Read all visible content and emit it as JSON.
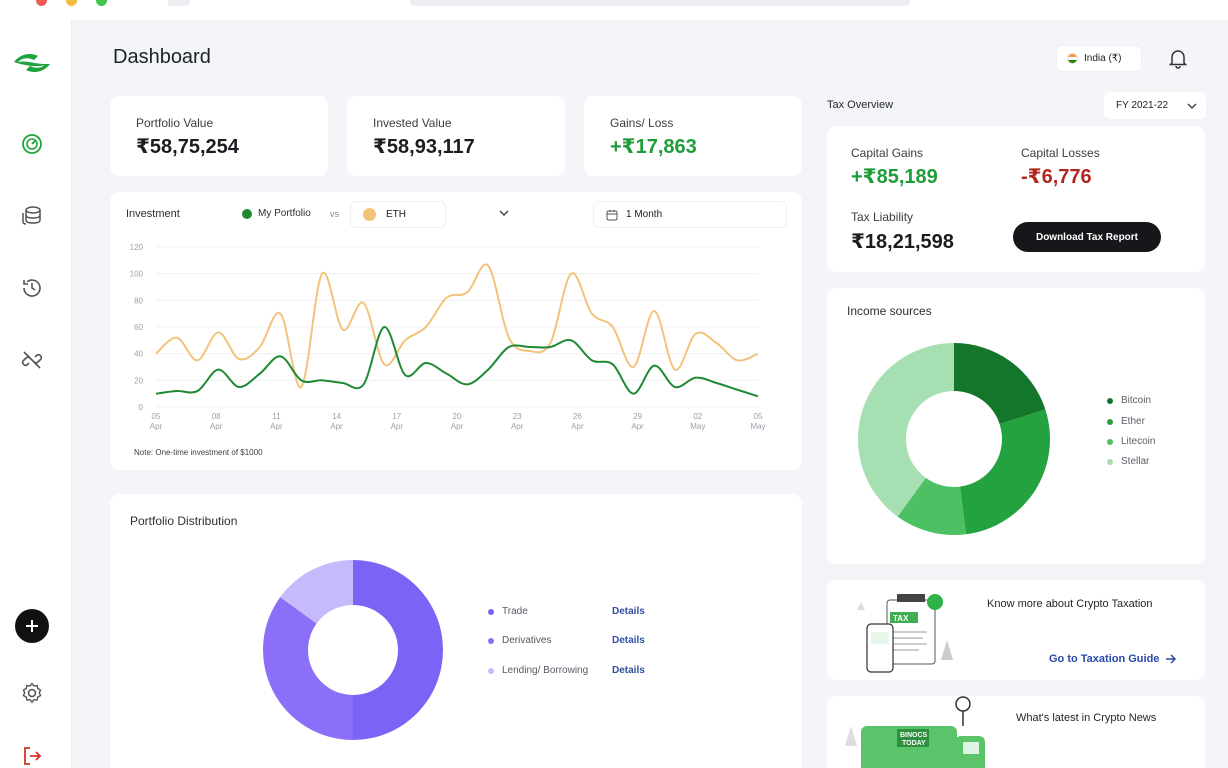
{
  "page": {
    "title": "Dashboard"
  },
  "region": {
    "label": "India (₹)"
  },
  "stats": [
    {
      "label": "Portfolio Value",
      "value": "₹58,75,254"
    },
    {
      "label": "Invested Value",
      "value": "₹58,93,117"
    },
    {
      "label": "Gains/ Loss",
      "value": "+₹17,863"
    }
  ],
  "investment": {
    "title": "Investment",
    "series_a_label": "My Portfolio",
    "vs": "vs",
    "series_b_label": "ETH",
    "period": "1 Month",
    "note": "Note: One-time investment of $1000",
    "colors": {
      "portfolio": "#1f8a34",
      "eth": "#f3c37b"
    }
  },
  "chart_data": {
    "type": "line",
    "x": [
      "05 Apr",
      "08 Apr",
      "11 Apr",
      "14 Apr",
      "17 Apr",
      "20 Apr",
      "23 Apr",
      "26 Apr",
      "29 Apr",
      "02 May",
      "05 May"
    ],
    "x_ticks": [
      {
        "day": "05",
        "mon": "Apr"
      },
      {
        "day": "08",
        "mon": "Apr"
      },
      {
        "day": "11",
        "mon": "Apr"
      },
      {
        "day": "14",
        "mon": "Apr"
      },
      {
        "day": "17",
        "mon": "Apr"
      },
      {
        "day": "20",
        "mon": "Apr"
      },
      {
        "day": "23",
        "mon": "Apr"
      },
      {
        "day": "26",
        "mon": "Apr"
      },
      {
        "day": "29",
        "mon": "Apr"
      },
      {
        "day": "02",
        "mon": "May"
      },
      {
        "day": "05",
        "mon": "May"
      }
    ],
    "yticks": [
      "0",
      "20",
      "40",
      "60",
      "80",
      "100",
      "120"
    ],
    "ylim": [
      0,
      120
    ],
    "series": [
      {
        "name": "My Portfolio",
        "values": [
          10,
          12,
          12,
          28,
          15,
          25,
          38,
          20,
          20,
          18,
          17,
          60,
          24,
          33,
          25,
          17,
          28,
          45,
          45,
          45,
          50,
          35,
          32,
          10,
          31,
          15,
          22,
          18,
          13,
          8
        ]
      },
      {
        "name": "ETH",
        "values": [
          40,
          52,
          35,
          56,
          36,
          45,
          70,
          15,
          100,
          58,
          78,
          32,
          50,
          60,
          82,
          86,
          106,
          52,
          42,
          48,
          100,
          70,
          60,
          30,
          72,
          28,
          55,
          48,
          35,
          40
        ]
      }
    ],
    "grid": true
  },
  "distribution": {
    "title": "Portfolio Distribution",
    "items": [
      {
        "label": "Trade",
        "action": "Details",
        "color": "#7b63f6",
        "share": 0.5
      },
      {
        "label": "Derivatives",
        "action": "Details",
        "color": "#8b6ff8",
        "share": 0.35
      },
      {
        "label": "Lending/ Borrowing",
        "action": "Details",
        "color": "#c6bafc",
        "share": 0.15
      }
    ]
  },
  "tax": {
    "title": "Tax Overview",
    "fy": "FY 2021-22",
    "capital_gains_label": "Capital Gains",
    "capital_gains_value": "+₹85,189",
    "capital_losses_label": "Capital Losses",
    "capital_losses_value": "-₹6,776",
    "liability_label": "Tax Liability",
    "liability_value": "₹18,21,598",
    "download_label": "Download Tax Report"
  },
  "income": {
    "title": "Income sources",
    "items": [
      {
        "label": "Bitcoin",
        "color": "#13762a",
        "share": 0.2
      },
      {
        "label": "Ether",
        "color": "#24a240",
        "share": 0.28
      },
      {
        "label": "Litecoin",
        "color": "#4dc064",
        "share": 0.12
      },
      {
        "label": "Stellar",
        "color": "#a6e0b2",
        "share": 0.4
      }
    ]
  },
  "promo_tax": {
    "title": "Know more about Crypto Taxation",
    "link": "Go to Taxation Guide",
    "badge": "TAX"
  },
  "promo_news": {
    "title": "What's latest in Crypto News",
    "truck_text_1": "BINOCS",
    "truck_text_2": "TODAY"
  }
}
